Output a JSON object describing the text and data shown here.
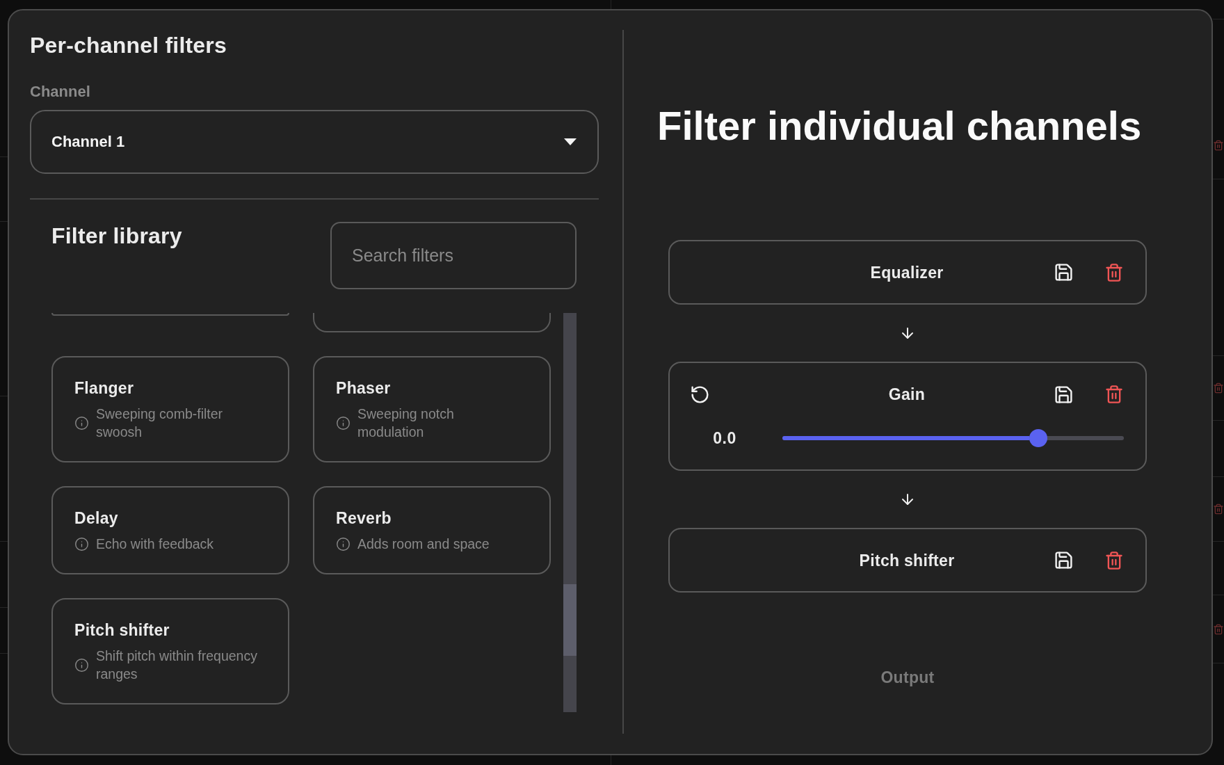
{
  "dialog": {
    "title": "Per-channel filters"
  },
  "channel": {
    "label": "Channel",
    "value": "Channel 1"
  },
  "filter_library": {
    "title": "Filter library",
    "search": {
      "placeholder": "Search filters"
    },
    "filters": [
      {
        "kind": "cut_off"
      },
      {
        "kind": "cut_off"
      },
      {
        "kind": "card",
        "name": "Flanger",
        "description": "Sweeping comb-filter swoosh"
      },
      {
        "kind": "card",
        "name": "Phaser",
        "description": "Sweeping notch modulation"
      },
      {
        "kind": "card",
        "name": "Delay",
        "description": "Echo with feedback"
      },
      {
        "kind": "card",
        "name": "Reverb",
        "description": "Adds room and space"
      },
      {
        "kind": "card",
        "name": "Pitch shifter",
        "description": "Shift pitch within frequency ranges"
      }
    ]
  },
  "chain": {
    "title": "Filter individual channels",
    "filters": [
      {
        "kind": "plain",
        "name": "Equalizer"
      },
      {
        "kind": "slider",
        "name": "Gain",
        "reading": "0.0",
        "level": 0.75
      },
      {
        "kind": "plain",
        "name": "Pitch shifter"
      }
    ],
    "output": "Output"
  }
}
